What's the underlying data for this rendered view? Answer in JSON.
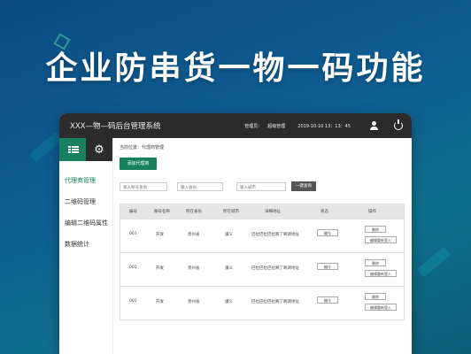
{
  "headline": "企业防串货一物一码功能",
  "app": {
    "title": "XXX—物—码后台管理系统",
    "role": "管理员：",
    "user": "超级管理",
    "datetime": "2019-10-10 13：13：45"
  },
  "sidebar": {
    "items": [
      {
        "label": "代理商管理"
      },
      {
        "label": "二维码管理"
      },
      {
        "label": "编辑二维码属性"
      },
      {
        "label": "数据统计"
      }
    ]
  },
  "main": {
    "breadcrumb": "当前位置：代理商管理",
    "add_button": "添加代理商",
    "search": {
      "code_placeholder": "输入账号查询",
      "province_placeholder": "输入省份",
      "city_placeholder": "输入城市",
      "query_button": "一键查询"
    },
    "table": {
      "headers": [
        "编号",
        "账号名称",
        "所在省份",
        "所在城市",
        "详细地址",
        "状态",
        "操作"
      ],
      "rows": [
        {
          "id": "001",
          "account": "开发",
          "province": "贵州省",
          "city": "遵义",
          "address": "巴拉巴拉巴拉啊了啊调地址",
          "status": "编号",
          "delete": "删除",
          "edit": "编辑重新登入"
        },
        {
          "id": "001",
          "account": "开发",
          "province": "贵州省",
          "city": "遵义",
          "address": "巴拉巴拉巴拉啊了啊调地址",
          "status": "编号",
          "delete": "删除",
          "edit": "编辑重新登入"
        },
        {
          "id": "001",
          "account": "开发",
          "province": "贵州省",
          "city": "遵义",
          "address": "巴拉巴拉巴拉啊了啊调地址",
          "status": "编号",
          "delete": "删除",
          "edit": "编辑重新登入"
        }
      ]
    }
  },
  "colors": {
    "accent": "#17805e",
    "topbar": "#2b2b2b",
    "background": "#0e5f92"
  }
}
